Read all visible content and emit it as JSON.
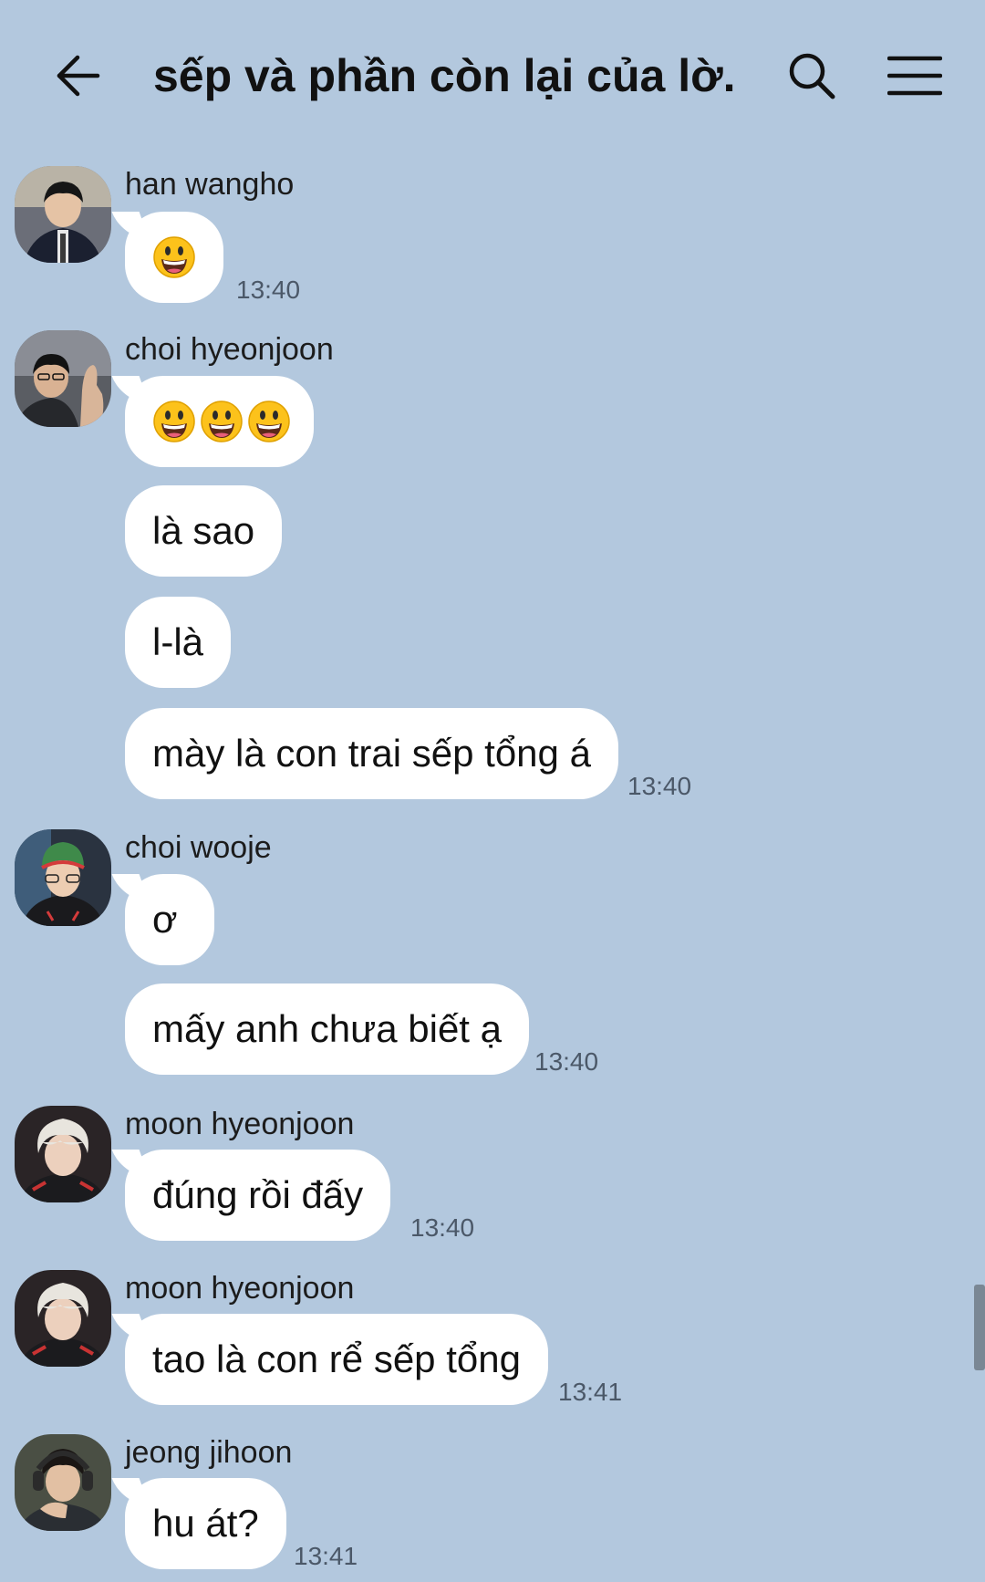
{
  "header": {
    "title": "sếp và phần còn lại của lờ...",
    "back_icon": "back-arrow-icon",
    "search_icon": "search-icon",
    "menu_icon": "hamburger-menu-icon"
  },
  "messages": [
    {
      "sender": "han wangho",
      "bubbles": [
        "😃"
      ],
      "time": "13:40"
    },
    {
      "sender": "choi hyeonjoon",
      "bubbles": [
        "😃😃😃",
        "là sao",
        "l-là",
        "mày là con trai sếp tổng á"
      ],
      "time": "13:40"
    },
    {
      "sender": "choi wooje",
      "bubbles": [
        "ơ",
        "mấy anh chưa biết ạ"
      ],
      "time": "13:40"
    },
    {
      "sender": "moon hyeonjoon",
      "bubbles": [
        "đúng rồi đấy"
      ],
      "time": "13:40"
    },
    {
      "sender": "moon hyeonjoon",
      "bubbles": [
        "tao là con rể sếp tổng"
      ],
      "time": "13:41"
    },
    {
      "sender": "jeong jihoon",
      "bubbles": [
        "hu át?"
      ],
      "time": "13:41"
    }
  ],
  "colors": {
    "background": "#b3c8de",
    "bubble": "#ffffff",
    "timestamp": "#4b5868"
  }
}
